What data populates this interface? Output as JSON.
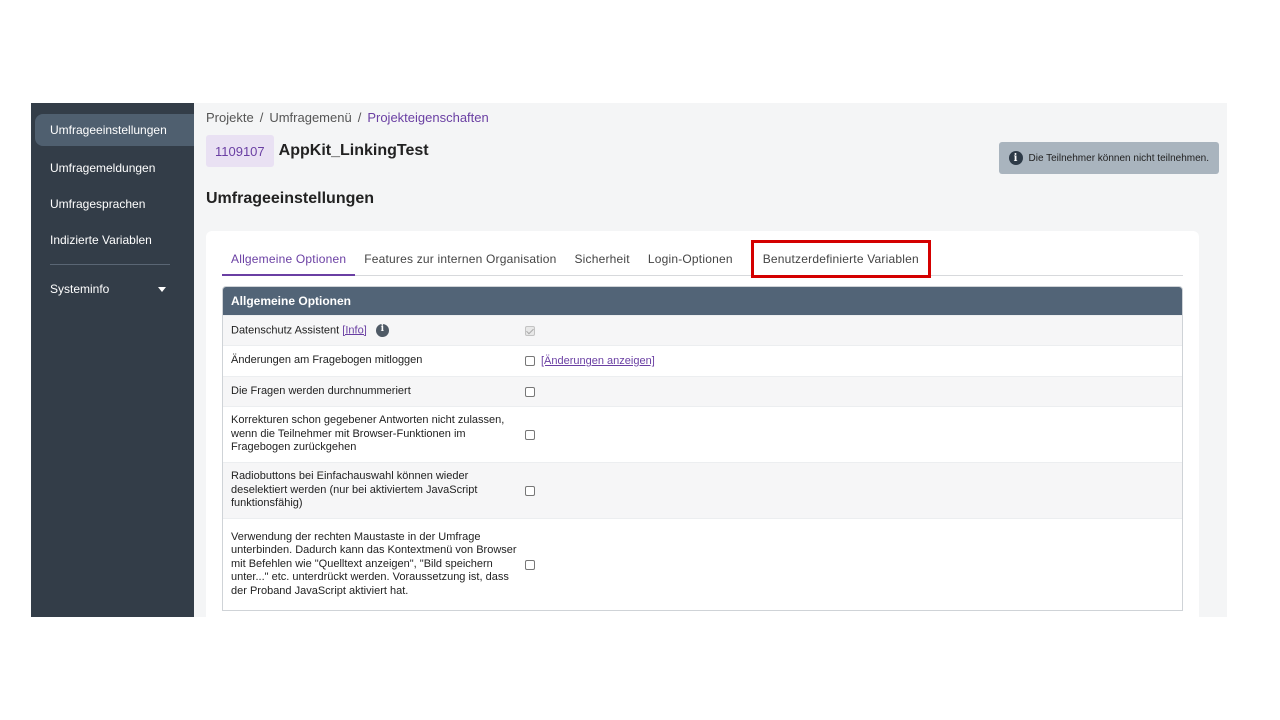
{
  "sidebar": {
    "items": [
      {
        "label": "Umfrageeinstellungen"
      },
      {
        "label": "Umfragemeldungen"
      },
      {
        "label": "Umfragesprachen"
      },
      {
        "label": "Indizierte Variablen"
      },
      {
        "label": "Systeminfo"
      }
    ]
  },
  "breadcrumb": {
    "items": [
      "Projekte",
      "Umfragemenü",
      "Projekteigenschaften"
    ],
    "separator": "/"
  },
  "header": {
    "survey_id": "1109107",
    "survey_name": "AppKit_LinkingTest",
    "status": "Die Teilnehmer können nicht teilnehmen.",
    "section_title": "Umfrageeinstellungen"
  },
  "tabs": [
    {
      "label": "Allgemeine Optionen"
    },
    {
      "label": "Features zur internen Organisation"
    },
    {
      "label": "Sicherheit"
    },
    {
      "label": "Login-Optionen"
    },
    {
      "label": "Benutzerdefinierte Variablen"
    }
  ],
  "panel": {
    "title": "Allgemeine Optionen",
    "rows": [
      {
        "label": "Datenschutz Assistent",
        "link": "[Info]"
      },
      {
        "label": "Änderungen am Fragebogen mitloggen",
        "link": "[Änderungen anzeigen]"
      },
      {
        "label": "Die Fragen werden durchnummeriert"
      },
      {
        "label": "Korrekturen schon gegebener Antworten nicht zulassen, wenn die Teilnehmer mit Browser-Funktionen im Fragebogen zurückgehen"
      },
      {
        "label": "Radiobuttons bei Einfachauswahl können wieder deselektiert werden (nur bei aktiviertem JavaScript funktionsfähig)"
      },
      {
        "label": "Verwendung der rechten Maustaste in der Umfrage unterbinden. Dadurch kann das Kontextmenü von Browser mit Befehlen wie \"Quelltext anzeigen\", \"Bild speichern unter...\" etc. unterdrückt werden. Voraussetzung ist, dass der Proband JavaScript aktiviert hat."
      }
    ]
  },
  "colors": {
    "accent": "#6a3fa3",
    "sidebar": "#333d48",
    "highlight": "#d40000",
    "panel_head": "#526477"
  }
}
